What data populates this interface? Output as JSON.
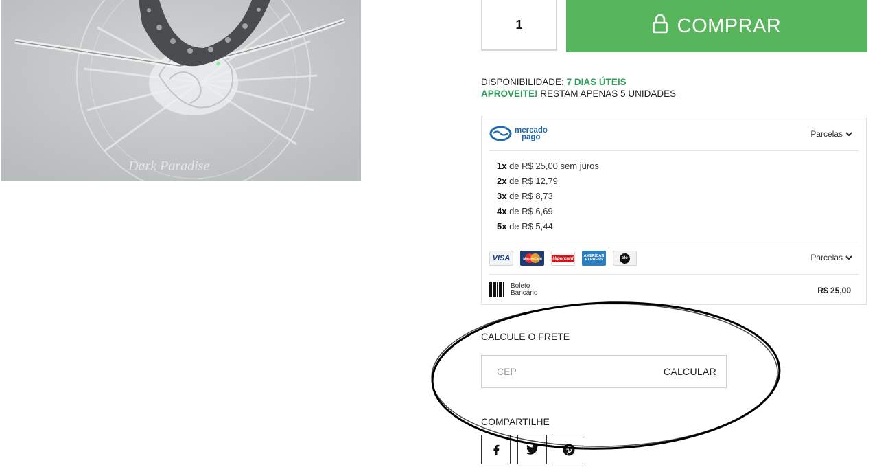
{
  "purchase": {
    "quantity": "1",
    "buy_label": "COMPRAR"
  },
  "availability": {
    "label": "DISPONIBILIDADE:",
    "value": "7 DIAS ÚTEIS",
    "promo_highlight": "APROVEITE!",
    "promo_text": "RESTAM APENAS 5 UNIDADES"
  },
  "payment": {
    "mercado_pago_line1": "mercado",
    "mercado_pago_line2": "pago",
    "parcelas_label": "Parcelas",
    "installments": [
      {
        "times": "1x",
        "text": " de R$ 25,00 sem juros"
      },
      {
        "times": "2x",
        "text": " de R$ 12,79"
      },
      {
        "times": "3x",
        "text": " de R$ 8,73"
      },
      {
        "times": "4x",
        "text": " de R$ 6,69"
      },
      {
        "times": "5x",
        "text": " de R$ 5,44"
      }
    ],
    "cards": [
      "VISA",
      "MasterCard",
      "Hipercard",
      "AMERICAN EXPRESS",
      "elo"
    ],
    "cards_parcelas_label": "Parcelas",
    "boleto_line1": "Boleto",
    "boleto_line2": "Bancário",
    "boleto_price": "R$ 25,00"
  },
  "shipping": {
    "title": "CALCULE O FRETE",
    "cep_placeholder": "CEP",
    "calculate_label": "CALCULAR"
  },
  "share": {
    "title": "COMPARTILHE"
  },
  "colors": {
    "buy_green": "#57b55b",
    "accent_green": "#2e9e5b",
    "mercado_pago_blue": "#1d67b3"
  }
}
